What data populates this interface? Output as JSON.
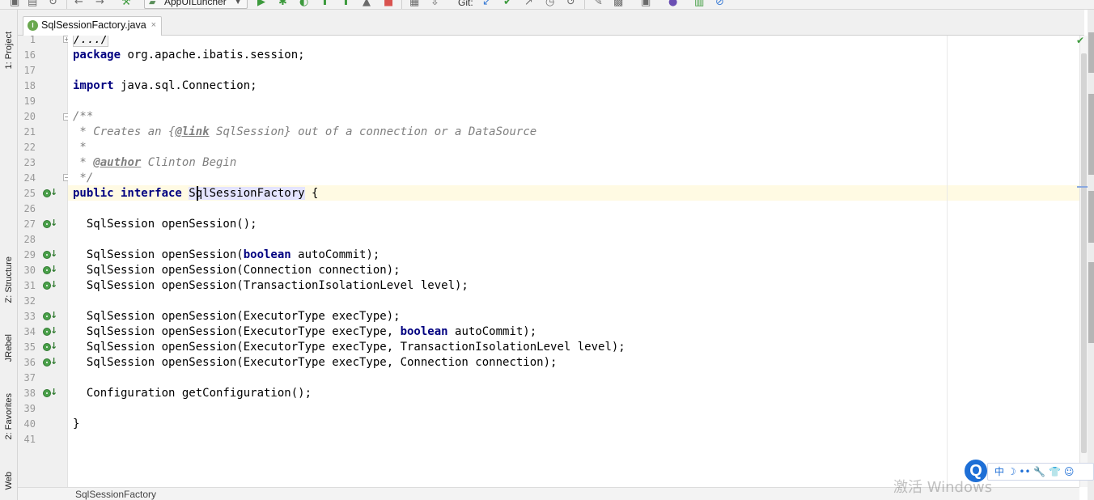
{
  "toolbar": {
    "run_config": "AppUILuncher",
    "git_label": "Git:"
  },
  "left_panel": {
    "tabs": [
      {
        "label": "1: Project"
      },
      {
        "label": "Z: Structure"
      },
      {
        "label": "JRebel"
      },
      {
        "label": "2: Favorites"
      },
      {
        "label": "Web"
      }
    ]
  },
  "editor_tab": {
    "filename": "SqlSessionFactory.java",
    "icon": "I"
  },
  "gutter": {
    "line_numbers": [
      "1",
      "16",
      "17",
      "18",
      "19",
      "20",
      "21",
      "22",
      "23",
      "24",
      "25",
      "26",
      "27",
      "28",
      "29",
      "30",
      "31",
      "32",
      "33",
      "34",
      "35",
      "36",
      "37",
      "38",
      "39",
      "40",
      "41"
    ]
  },
  "code": {
    "l1": "/.../",
    "l16_kw": "package",
    "l16_rest": " org.apache.ibatis.session;",
    "l18_kw": "import",
    "l18_rest": " java.sql.Connection;",
    "l20": "/**",
    "l21_a": " * Creates an {",
    "l21_tag": "@link",
    "l21_b": " SqlSession} out of a connection or a DataSource",
    "l22": " *",
    "l23_a": " * ",
    "l23_tag": "@author",
    "l23_b": " Clinton Begin",
    "l24": " */",
    "l25_kw": "public interface",
    "l25_name": "SqlSessionFactory",
    "l25_rest": " {",
    "l27": "  SqlSession openSession();",
    "l29_a": "  SqlSession openSession(",
    "l29_kw": "boolean",
    "l29_b": " autoCommit);",
    "l30": "  SqlSession openSession(Connection connection);",
    "l31": "  SqlSession openSession(TransactionIsolationLevel level);",
    "l33": "  SqlSession openSession(ExecutorType execType);",
    "l34_a": "  SqlSession openSession(ExecutorType execType, ",
    "l34_kw": "boolean",
    "l34_b": " autoCommit);",
    "l35": "  SqlSession openSession(ExecutorType execType, TransactionIsolationLevel level);",
    "l36": "  SqlSession openSession(ExecutorType execType, Connection connection);",
    "l38": "  Configuration getConfiguration();",
    "l40": "}"
  },
  "breadcrumb": {
    "text": "SqlSessionFactory"
  },
  "ime": {
    "logo": "Q",
    "items": "中 ☽ •• 🔧 👕 ☺"
  },
  "watermark": {
    "text": "激活 Windows"
  },
  "colors": {
    "keyword": "#000080",
    "comment": "#808080",
    "caret_row": "#fffae3",
    "implementation_marker": "#4aa04a"
  }
}
